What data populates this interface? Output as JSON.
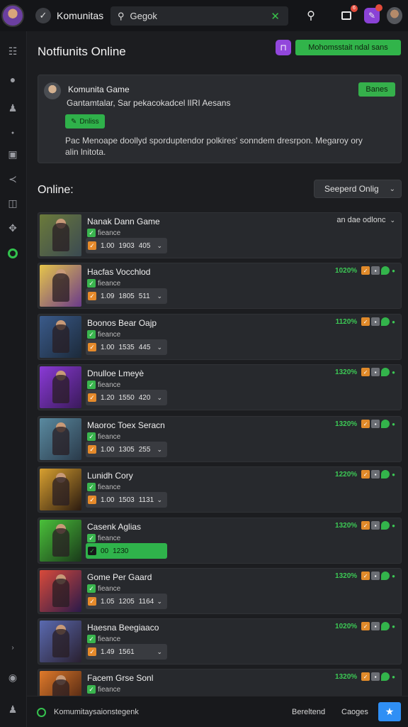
{
  "topbar": {
    "app_title": "Komunitas",
    "search_value": "Gegok",
    "notification_count": "6"
  },
  "header": {
    "title": "Notfiunits Online",
    "action_label": "Mohomsstait ndal sans"
  },
  "card": {
    "title": "Komunita Game",
    "subtitle": "Gantamtalar, Sar pekacokadcel lIRI Aesans",
    "button_label": "Banes",
    "pill_label": "Dnliss",
    "description": "Pac Menoape doollyd sporduptendor polkires' sonndem dresrpon. Megaroy ory alin lnitota."
  },
  "online": {
    "section_title": "Online:",
    "sort_label": "Seeperd Onlig",
    "first_right_label": "an dae odlonc"
  },
  "rows": [
    {
      "name": "Nanak Dann Game",
      "status": "fieance",
      "stat_a": "1.00",
      "stat_b": "1903",
      "stat_c": "405",
      "pct": "",
      "colors": [
        "#6b7a3a",
        "#3b4a52"
      ]
    },
    {
      "name": "Hacfas Vocchlod",
      "status": "fieance",
      "stat_a": "1.09",
      "stat_b": "1805",
      "stat_c": "511",
      "pct": "1020%",
      "colors": [
        "#e6c54a",
        "#6a3a8a"
      ]
    },
    {
      "name": "Boonos Bear Oajp",
      "status": "fieance",
      "stat_a": "1.00",
      "stat_b": "1535",
      "stat_c": "445",
      "pct": "1120%",
      "colors": [
        "#3a5a8a",
        "#1c2a3a"
      ]
    },
    {
      "name": "Dnulloe Lmeyè",
      "status": "fieance",
      "stat_a": "1.20",
      "stat_b": "1550",
      "stat_c": "420",
      "pct": "1320%",
      "colors": [
        "#8a3ad6",
        "#3a1a5a"
      ]
    },
    {
      "name": "Maoroc Toex Seracn",
      "status": "fieance",
      "stat_a": "1.00",
      "stat_b": "1305",
      "stat_c": "255",
      "pct": "1320%",
      "colors": [
        "#5a8aa0",
        "#2a3a4a"
      ]
    },
    {
      "name": "Lunidh Cory",
      "status": "fieance",
      "stat_a": "1.00",
      "stat_b": "1503",
      "stat_c": "1131",
      "pct": "1220%",
      "colors": [
        "#d8a030",
        "#2a1a10"
      ]
    },
    {
      "name": "Casenk Aglias",
      "status": "fieance",
      "stat_a": "00",
      "stat_b": "1230",
      "stat_c": "",
      "pct": "1320%",
      "active": true,
      "colors": [
        "#4ac03a",
        "#1a3a1a"
      ]
    },
    {
      "name": "Gome Per Gaard",
      "status": "fieance",
      "stat_a": "1.05",
      "stat_b": "1205",
      "stat_c": "1164",
      "pct": "1320%",
      "colors": [
        "#d84a3a",
        "#2a1a4a"
      ]
    },
    {
      "name": "Haesna Beegiaaco",
      "status": "fieance",
      "stat_a": "1.49",
      "stat_b": "1561",
      "stat_c": "",
      "pct": "1020%",
      "colors": [
        "#5a6ab0",
        "#2a2030"
      ]
    },
    {
      "name": "Facem Grse Sonl",
      "status": "fieance",
      "stat_a": "",
      "stat_b": "",
      "stat_c": "",
      "pct": "1320%",
      "colors": [
        "#e07a2a",
        "#3a1a10"
      ]
    }
  ],
  "bottombar": {
    "status_text": "Komumitaysaionstegenk",
    "link1": "Bereltend",
    "link2": "Caoges"
  },
  "colors": {
    "accent_green": "#32b44a",
    "accent_purple": "#8a42d6",
    "accent_blue": "#2f8ff5"
  }
}
